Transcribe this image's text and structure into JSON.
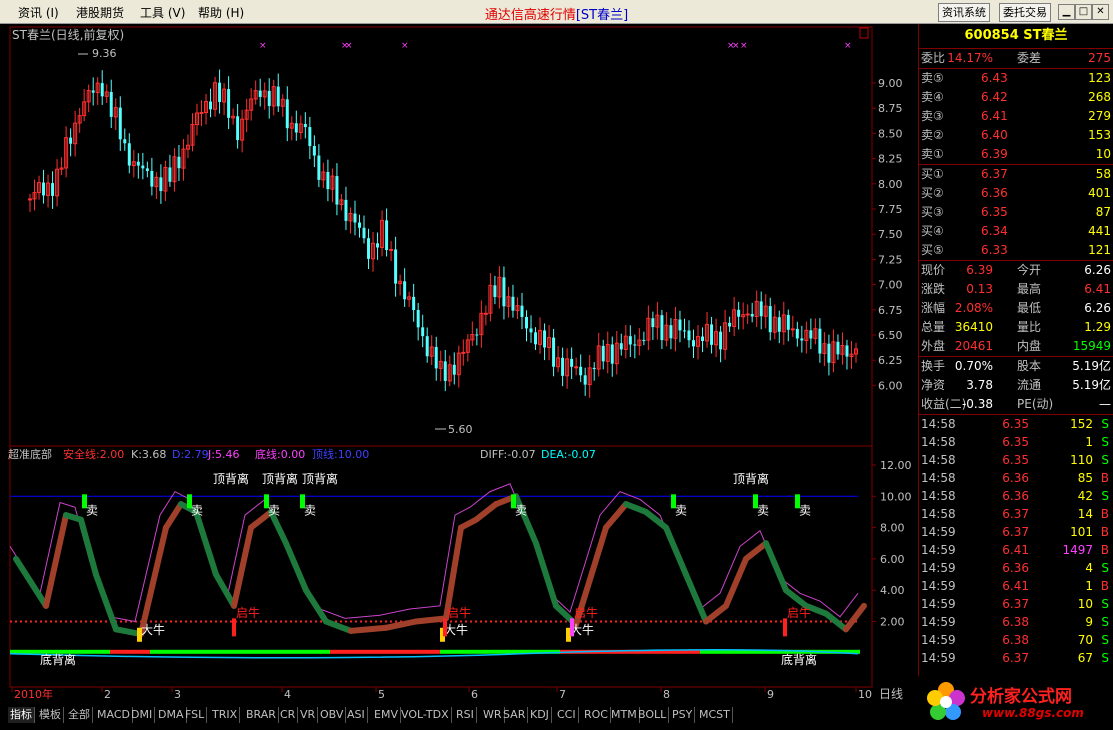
{
  "menu": {
    "items": [
      "资讯 (I)",
      "港股期货",
      "工具 (V)",
      "帮助 (H)"
    ],
    "app_title": "通达信高速行情",
    "app_subtitle": "[ST春兰]",
    "btn_info": "资讯系统",
    "btn_trade": "委托交易"
  },
  "window_buttons": [
    "minimize-icon",
    "maximize-icon",
    "close-icon"
  ],
  "price_chart": {
    "header": "ST春兰(日线,前复权)",
    "high_label": "9.36",
    "low_label": "5.60",
    "price_axis": [
      "9.00",
      "8.75",
      "8.50",
      "8.25",
      "8.00",
      "7.75",
      "7.50",
      "7.25",
      "7.00",
      "6.75",
      "6.50",
      "6.25",
      "6.00"
    ]
  },
  "indicator": {
    "name": "超准底部",
    "safe_line": "安全线:2.00",
    "k": "K:3.68",
    "d": "D:2.79",
    "j": "J:5.46",
    "bottom_line": "底线:0.00",
    "top_line": "顶线:10.00",
    "diff": "DIFF:-0.07",
    "dea": "DEA:-0.07",
    "axis": [
      "12.00",
      "10.00",
      "8.00",
      "6.00",
      "4.00",
      "2.00"
    ],
    "top_divergence": [
      "顶背离",
      "顶背离",
      "顶背离",
      "顶背离"
    ],
    "bottom_divergence": [
      "底背离",
      "底背离"
    ],
    "sell_label": "卖",
    "buy_label": "大牛",
    "start_label": "启牛"
  },
  "x_axis": {
    "labels": [
      "2010年",
      "2",
      "3",
      "4",
      "5",
      "6",
      "7",
      "8",
      "9",
      "10"
    ],
    "period": "日线"
  },
  "bottom_tabs": [
    "指标",
    "模板",
    "全部",
    "MACD",
    "DMI",
    "DMA",
    "FSL",
    "TRIX",
    "BRAR",
    "CR",
    "VR",
    "OBV",
    "ASI",
    "EMV",
    "VOL-TDX",
    "RSI",
    "WR",
    "SAR",
    "KDJ",
    "CCI",
    "ROC",
    "MTM",
    "BOLL",
    "PSY",
    "MCST"
  ],
  "quote": {
    "code": "600854 ST春兰",
    "weibi_label": "委比",
    "weibi": "14.17%",
    "weicha_label": "委差",
    "weicha": "275",
    "sell": [
      {
        "label": "卖⑤",
        "price": "6.43",
        "vol": "123"
      },
      {
        "label": "卖④",
        "price": "6.42",
        "vol": "268"
      },
      {
        "label": "卖③",
        "price": "6.41",
        "vol": "279"
      },
      {
        "label": "卖②",
        "price": "6.40",
        "vol": "153"
      },
      {
        "label": "卖①",
        "price": "6.39",
        "vol": "10"
      }
    ],
    "buy": [
      {
        "label": "买①",
        "price": "6.37",
        "vol": "58"
      },
      {
        "label": "买②",
        "price": "6.36",
        "vol": "401"
      },
      {
        "label": "买③",
        "price": "6.35",
        "vol": "87"
      },
      {
        "label": "买④",
        "price": "6.34",
        "vol": "441"
      },
      {
        "label": "买⑤",
        "price": "6.33",
        "vol": "121"
      }
    ],
    "stats": [
      {
        "l1": "现价",
        "v1": "6.39",
        "c1": "#ff3030",
        "l2": "今开",
        "v2": "6.26",
        "c2": "#ffffff"
      },
      {
        "l1": "涨跌",
        "v1": "0.13",
        "c1": "#ff3030",
        "l2": "最高",
        "v2": "6.41",
        "c2": "#ff3030"
      },
      {
        "l1": "涨幅",
        "v1": "2.08%",
        "c1": "#ff3030",
        "l2": "最低",
        "v2": "6.26",
        "c2": "#ffffff"
      },
      {
        "l1": "总量",
        "v1": "36410",
        "c1": "#ffff00",
        "l2": "量比",
        "v2": "1.29",
        "c2": "#ffff00"
      },
      {
        "l1": "外盘",
        "v1": "20461",
        "c1": "#ff3030",
        "l2": "内盘",
        "v2": "15949",
        "c2": "#00ff00"
      }
    ],
    "stats2": [
      {
        "l1": "换手",
        "v1": "0.70%",
        "l2": "股本",
        "v2": "5.19亿"
      },
      {
        "l1": "净资",
        "v1": "3.78",
        "l2": "流通",
        "v2": "5.19亿"
      },
      {
        "l1": "收益(二)",
        "v1": "-0.38",
        "l2": "PE(动)",
        "v2": "—"
      }
    ],
    "ticks": [
      {
        "time": "14:58",
        "price": "6.35",
        "vol": "152",
        "side": "S"
      },
      {
        "time": "14:58",
        "price": "6.35",
        "vol": "1",
        "side": "S"
      },
      {
        "time": "14:58",
        "price": "6.35",
        "vol": "110",
        "side": "S"
      },
      {
        "time": "14:58",
        "price": "6.36",
        "vol": "85",
        "side": "B"
      },
      {
        "time": "14:58",
        "price": "6.36",
        "vol": "42",
        "side": "S"
      },
      {
        "time": "14:58",
        "price": "6.37",
        "vol": "14",
        "side": "B"
      },
      {
        "time": "14:59",
        "price": "6.37",
        "vol": "101",
        "side": "B"
      },
      {
        "time": "14:59",
        "price": "6.41",
        "vol": "1497",
        "side": "B"
      },
      {
        "time": "14:59",
        "price": "6.36",
        "vol": "4",
        "side": "S"
      },
      {
        "time": "14:59",
        "price": "6.41",
        "vol": "1",
        "side": "B"
      },
      {
        "time": "14:59",
        "price": "6.37",
        "vol": "10",
        "side": "S"
      },
      {
        "time": "14:59",
        "price": "6.38",
        "vol": "9",
        "side": "S"
      },
      {
        "time": "14:59",
        "price": "6.38",
        "vol": "70",
        "side": "S"
      },
      {
        "time": "14:59",
        "price": "6.37",
        "vol": "67",
        "side": "S"
      }
    ]
  },
  "logo": {
    "name": "分析家公式网",
    "url": "www.88gs.com"
  },
  "colors": {
    "up": "#ff3030",
    "down": "#54ffff",
    "bg": "#000000",
    "frame": "#800000"
  }
}
